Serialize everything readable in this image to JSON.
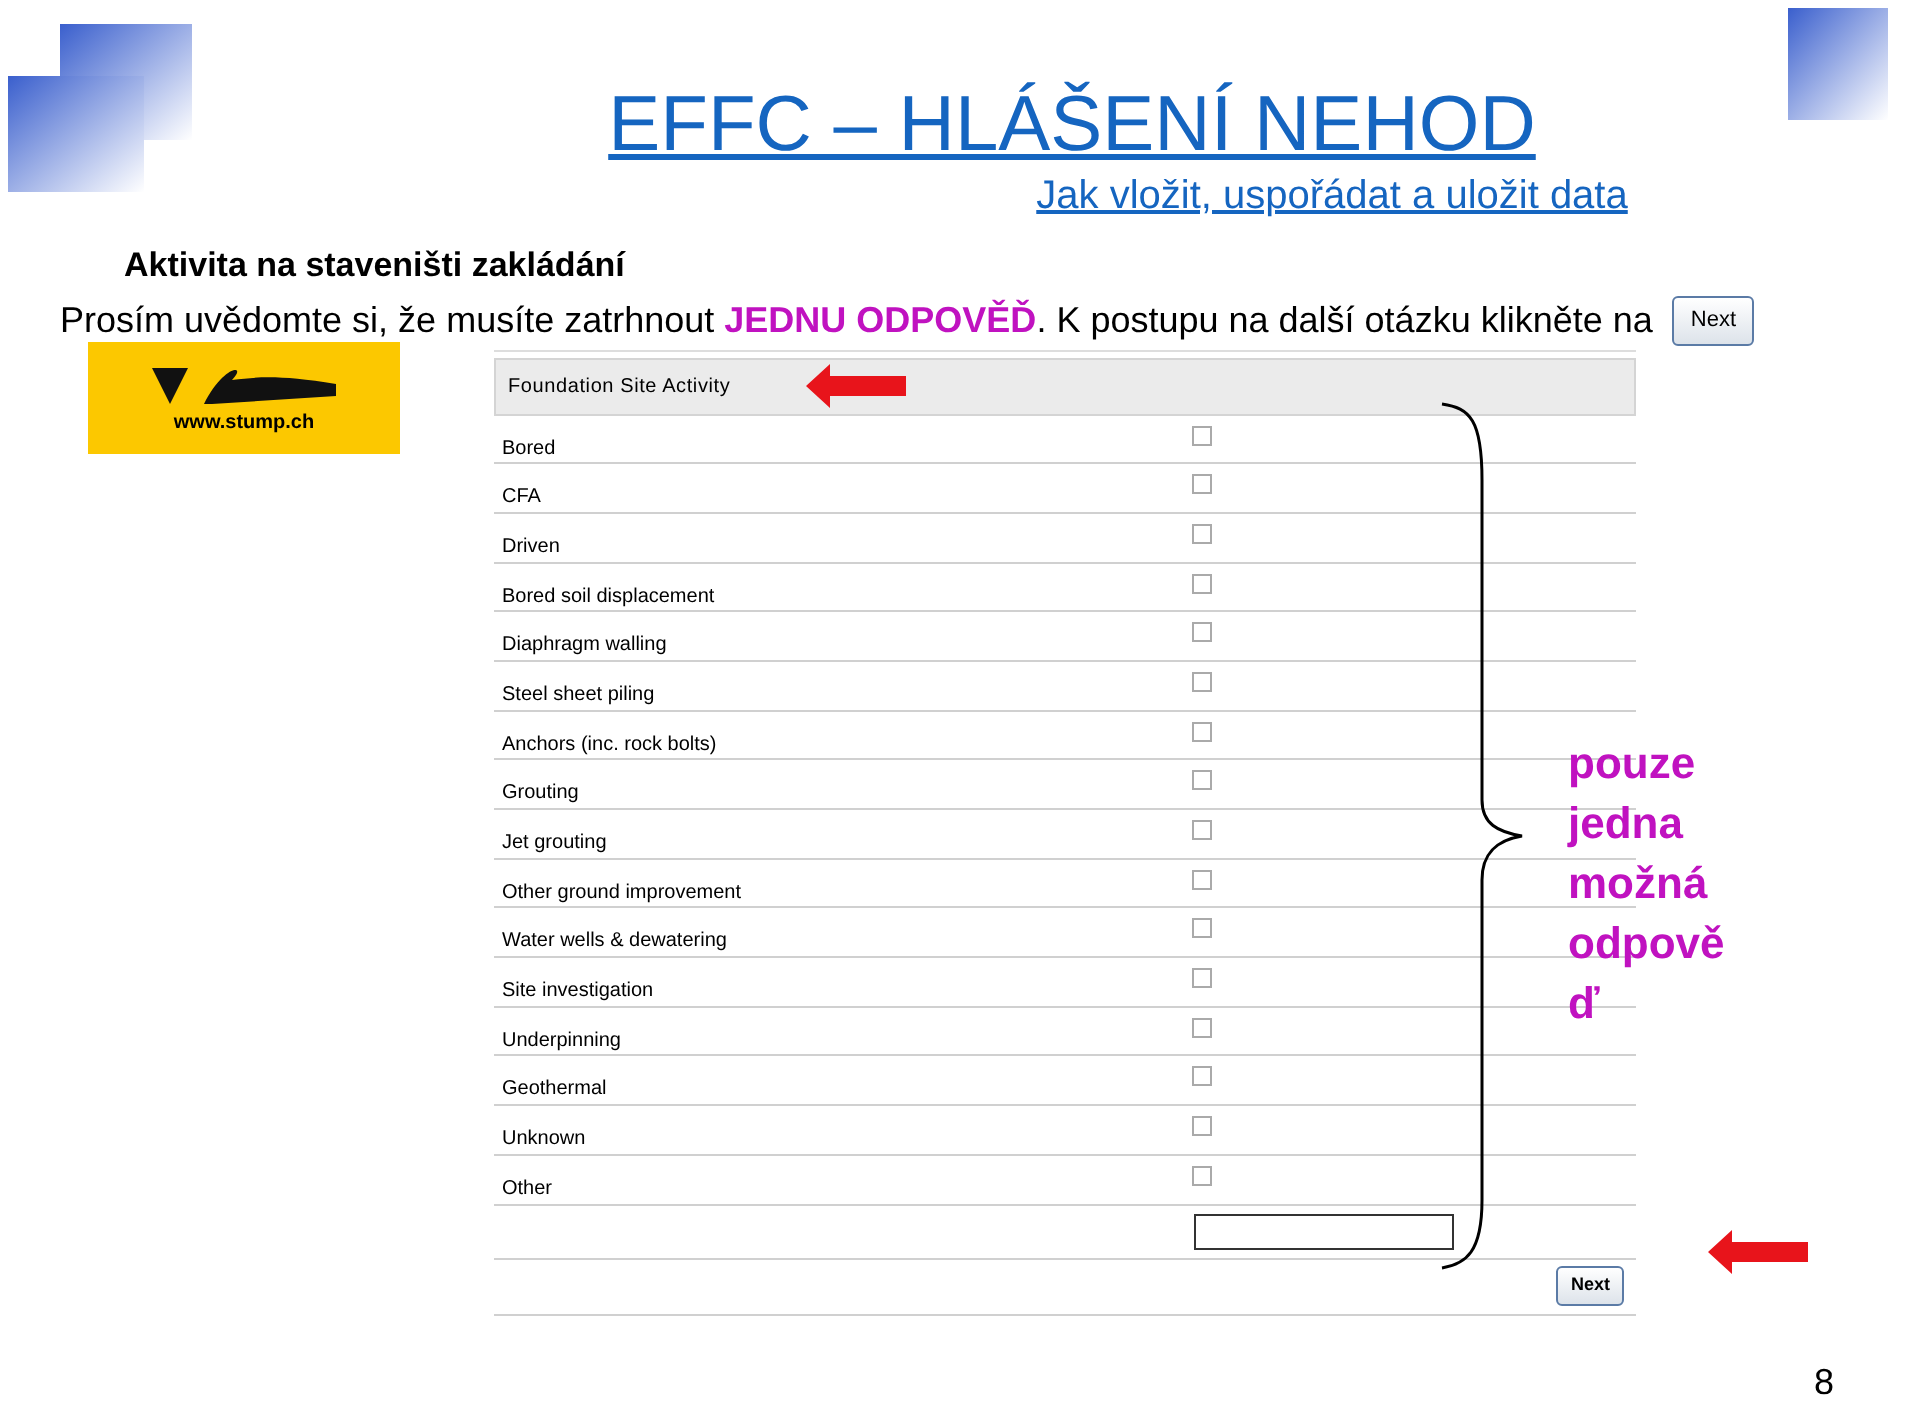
{
  "slide": {
    "title": "EFFC – HLÁŠENÍ NEHOD",
    "subtitle": "Jak vložit, uspořádat a uložit data",
    "heading": "Aktivita na staveništi zakládání",
    "instruction": "Prosím uvědomte si, že musíte zatrhnout **JEDNU ODPOVĚĎ**. K postupu na další otázku klikněte na",
    "instruction_button": "Next",
    "logo_text": "www.stump.ch",
    "annotation": "pouze jedna možná odpověď",
    "page_number": "8"
  },
  "form": {
    "title": "Foundation Site Activity",
    "options": [
      {
        "label": "Bored",
        "checked": false
      },
      {
        "label": "CFA",
        "checked": false
      },
      {
        "label": "Driven",
        "checked": false
      },
      {
        "label": "Bored soil displacement",
        "checked": false
      },
      {
        "label": "Diaphragm walling",
        "checked": false
      },
      {
        "label": "Steel sheet piling",
        "checked": false
      },
      {
        "label": "Anchors (inc. rock bolts)",
        "checked": false
      },
      {
        "label": "Grouting",
        "checked": false
      },
      {
        "label": "Jet grouting",
        "checked": false
      },
      {
        "label": "Other ground improvement",
        "checked": false
      },
      {
        "label": "Water wells & dewatering",
        "checked": false
      },
      {
        "label": "Site investigation",
        "checked": false
      },
      {
        "label": "Underpinning",
        "checked": false
      },
      {
        "label": "Geothermal",
        "checked": false
      },
      {
        "label": "Unknown",
        "checked": false
      },
      {
        "label": "Other",
        "checked": false
      }
    ],
    "next_button": "Next"
  }
}
